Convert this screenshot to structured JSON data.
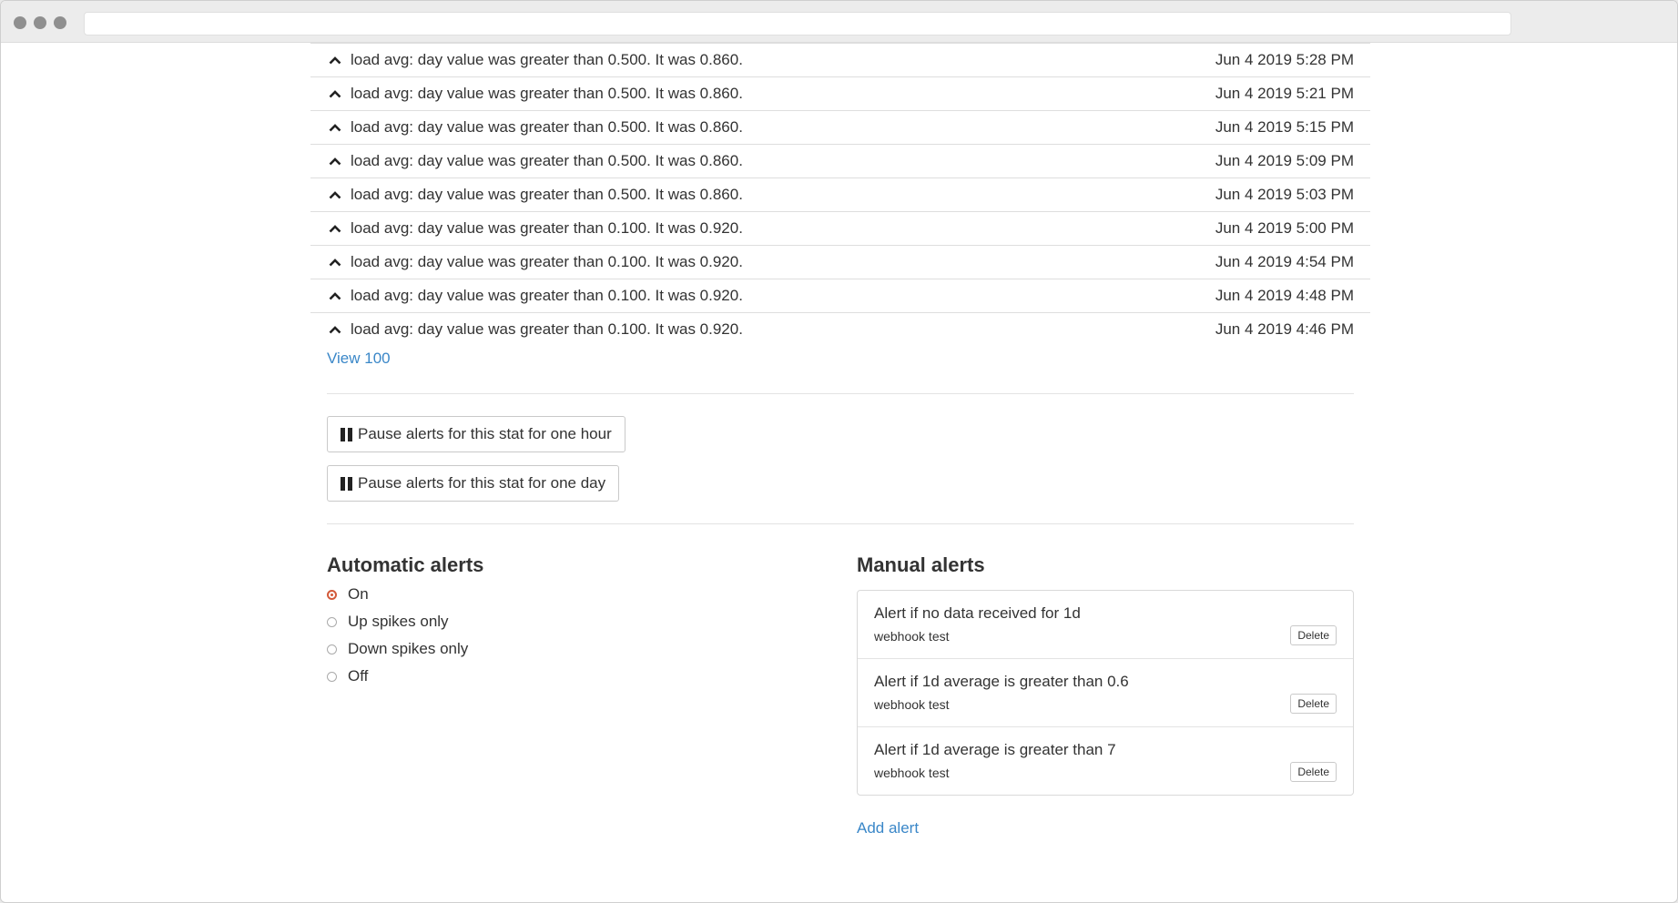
{
  "alert_history": [
    {
      "message": "load avg: day value was greater than 0.500. It was 0.860.",
      "time": "Jun 4 2019 5:28 PM"
    },
    {
      "message": "load avg: day value was greater than 0.500. It was 0.860.",
      "time": "Jun 4 2019 5:21 PM"
    },
    {
      "message": "load avg: day value was greater than 0.500. It was 0.860.",
      "time": "Jun 4 2019 5:15 PM"
    },
    {
      "message": "load avg: day value was greater than 0.500. It was 0.860.",
      "time": "Jun 4 2019 5:09 PM"
    },
    {
      "message": "load avg: day value was greater than 0.500. It was 0.860.",
      "time": "Jun 4 2019 5:03 PM"
    },
    {
      "message": "load avg: day value was greater than 0.100. It was 0.920.",
      "time": "Jun 4 2019 5:00 PM"
    },
    {
      "message": "load avg: day value was greater than 0.100. It was 0.920.",
      "time": "Jun 4 2019 4:54 PM"
    },
    {
      "message": "load avg: day value was greater than 0.100. It was 0.920.",
      "time": "Jun 4 2019 4:48 PM"
    },
    {
      "message": "load avg: day value was greater than 0.100. It was 0.920.",
      "time": "Jun 4 2019 4:46 PM"
    }
  ],
  "view_more": "View 100",
  "pause_buttons": {
    "hour": "Pause alerts for this stat for one hour",
    "day": "Pause alerts for this stat for one day"
  },
  "automatic_alerts": {
    "heading": "Automatic alerts",
    "options": [
      "On",
      "Up spikes only",
      "Down spikes only",
      "Off"
    ],
    "selected": "On"
  },
  "manual_alerts": {
    "heading": "Manual alerts",
    "items": [
      {
        "title": "Alert if no data received for 1d",
        "channel": "webhook test",
        "delete_label": "Delete"
      },
      {
        "title": "Alert if 1d average is greater than 0.6",
        "channel": "webhook test",
        "delete_label": "Delete"
      },
      {
        "title": "Alert if 1d average is greater than 7",
        "channel": "webhook test",
        "delete_label": "Delete"
      }
    ],
    "add_label": "Add alert"
  },
  "colors": {
    "link": "#3a87c8",
    "radio_selected": "#d35a3a"
  }
}
